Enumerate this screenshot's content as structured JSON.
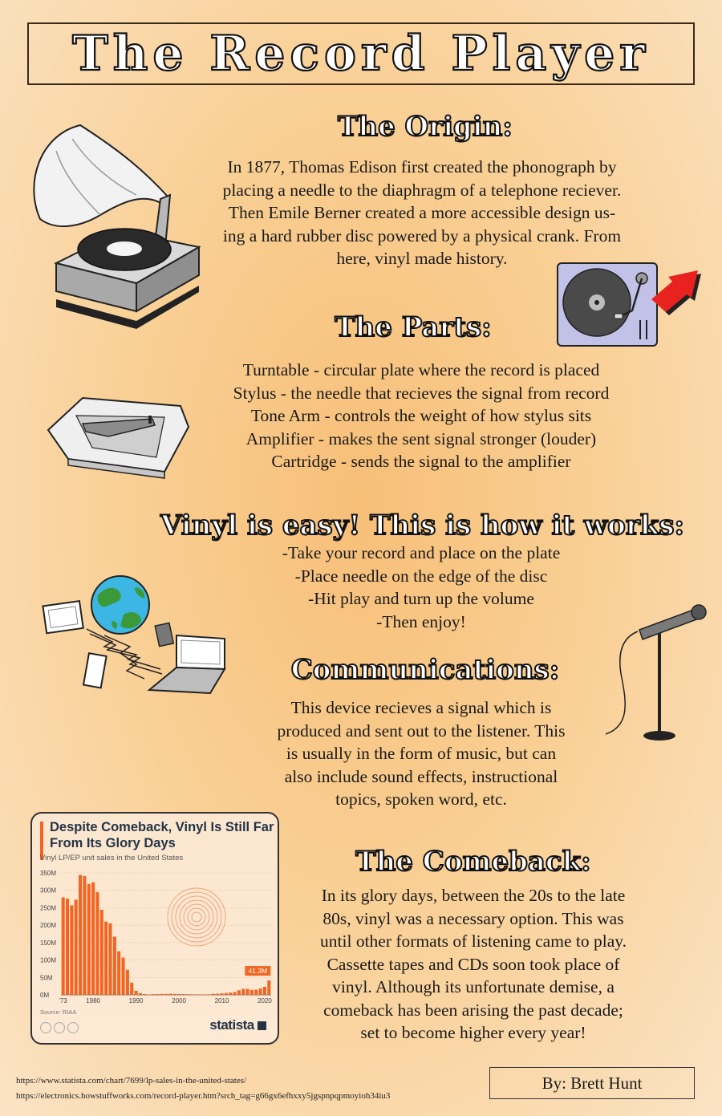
{
  "title": "The Record Player",
  "origin": {
    "heading": "The Origin:",
    "lines": [
      "In 1877, Thomas Edison first created the phonograph by",
      "placing a needle to the diaphragm of a telephone reciever.",
      "Then Emile Berner created a more accessible design us-",
      "ing a hard rubber disc powered by a physical crank. From",
      "here, vinyl made history."
    ]
  },
  "parts": {
    "heading": "The Parts:",
    "lines": [
      "Turntable - circular plate where the record is placed",
      "Stylus - the needle that recieves the signal from record",
      "Tone Arm - controls the weight of how stylus sits",
      "Amplifier - makes the sent signal stronger (louder)",
      "Cartridge - sends the signal to the amplifier"
    ]
  },
  "howto": {
    "heading": "Vinyl is easy! This is how it works:",
    "lines": [
      "-Take your record and place on the plate",
      "-Place needle on the edge of the disc",
      "-Hit play and turn up the volume",
      "-Then enjoy!"
    ]
  },
  "communications": {
    "heading": "Communications:",
    "lines": [
      "This device recieves a signal which is",
      "produced and sent out to the listener. This",
      "is usually in the form of music, but can",
      "also include sound effects, instructional",
      "topics, spoken word, etc."
    ]
  },
  "comeback": {
    "heading": "The Comeback:",
    "lines": [
      "In its glory days, between the 20s to the late",
      "80s, vinyl was a necessary option. This was",
      "until other formats of listening came to play.",
      "Cassette tapes and CDs soon took place of",
      "vinyl. Although its unfortunate demise, a",
      "comeback has been arising the past decade;",
      "set to become higher every year!"
    ]
  },
  "chart_card": {
    "title": "Despite Comeback, Vinyl Is Still Far From Its Glory Days",
    "subtitle": "Vinyl LP/EP unit sales in the United States",
    "source": "Source: RIAA",
    "brand": "statista",
    "callout": "41.3M"
  },
  "chart_data": {
    "type": "bar",
    "title": "Despite Comeback, Vinyl Is Still Far From Its Glory Days",
    "subtitle": "Vinyl LP/EP unit sales in the United States",
    "x": [
      1973,
      1974,
      1975,
      1976,
      1977,
      1978,
      1979,
      1980,
      1981,
      1982,
      1983,
      1984,
      1985,
      1986,
      1987,
      1988,
      1989,
      1990,
      1991,
      1992,
      1993,
      1994,
      1995,
      1996,
      1997,
      1998,
      1999,
      2000,
      2001,
      2002,
      2003,
      2004,
      2005,
      2006,
      2007,
      2008,
      2009,
      2010,
      2011,
      2012,
      2013,
      2014,
      2015,
      2016,
      2017,
      2018,
      2019,
      2020,
      2021
    ],
    "values": [
      280,
      276,
      257,
      273,
      344,
      341,
      318,
      323,
      295,
      244,
      210,
      205,
      167,
      125,
      107,
      72,
      35,
      11.7,
      4.8,
      2.3,
      1.2,
      1.9,
      2.2,
      2.9,
      2.7,
      3.4,
      2.9,
      2.2,
      2.3,
      1.7,
      1.5,
      1.4,
      1.0,
      0.9,
      1.3,
      2.9,
      3.2,
      4.1,
      5.3,
      6.5,
      8.0,
      13.0,
      17.0,
      17.0,
      14.0,
      15.0,
      18.0,
      23.0,
      41.3
    ],
    "y_tick_labels": [
      "0M",
      "50M",
      "100M",
      "150M",
      "200M",
      "250M",
      "300M",
      "350M"
    ],
    "x_tick_labels": [
      "'73",
      "1980",
      "1990",
      "2000",
      "2010",
      "2020"
    ],
    "x_tick_years": [
      1973,
      1980,
      1990,
      2000,
      2010,
      2020
    ],
    "ylim": [
      0,
      350
    ],
    "grid": true,
    "bar_color": "#f26522",
    "annotation": {
      "year": 2021,
      "label": "41.3M"
    }
  },
  "references": [
    "https://www.statista.com/chart/7699/lp-sales-in-the-united-states/",
    "https://electronics.howstuffworks.com/record-player.htm?srch_tag=g66gx6efhxxy5jgspnpqpmoyioh34iu3"
  ],
  "author": "By: Brett Hunt"
}
